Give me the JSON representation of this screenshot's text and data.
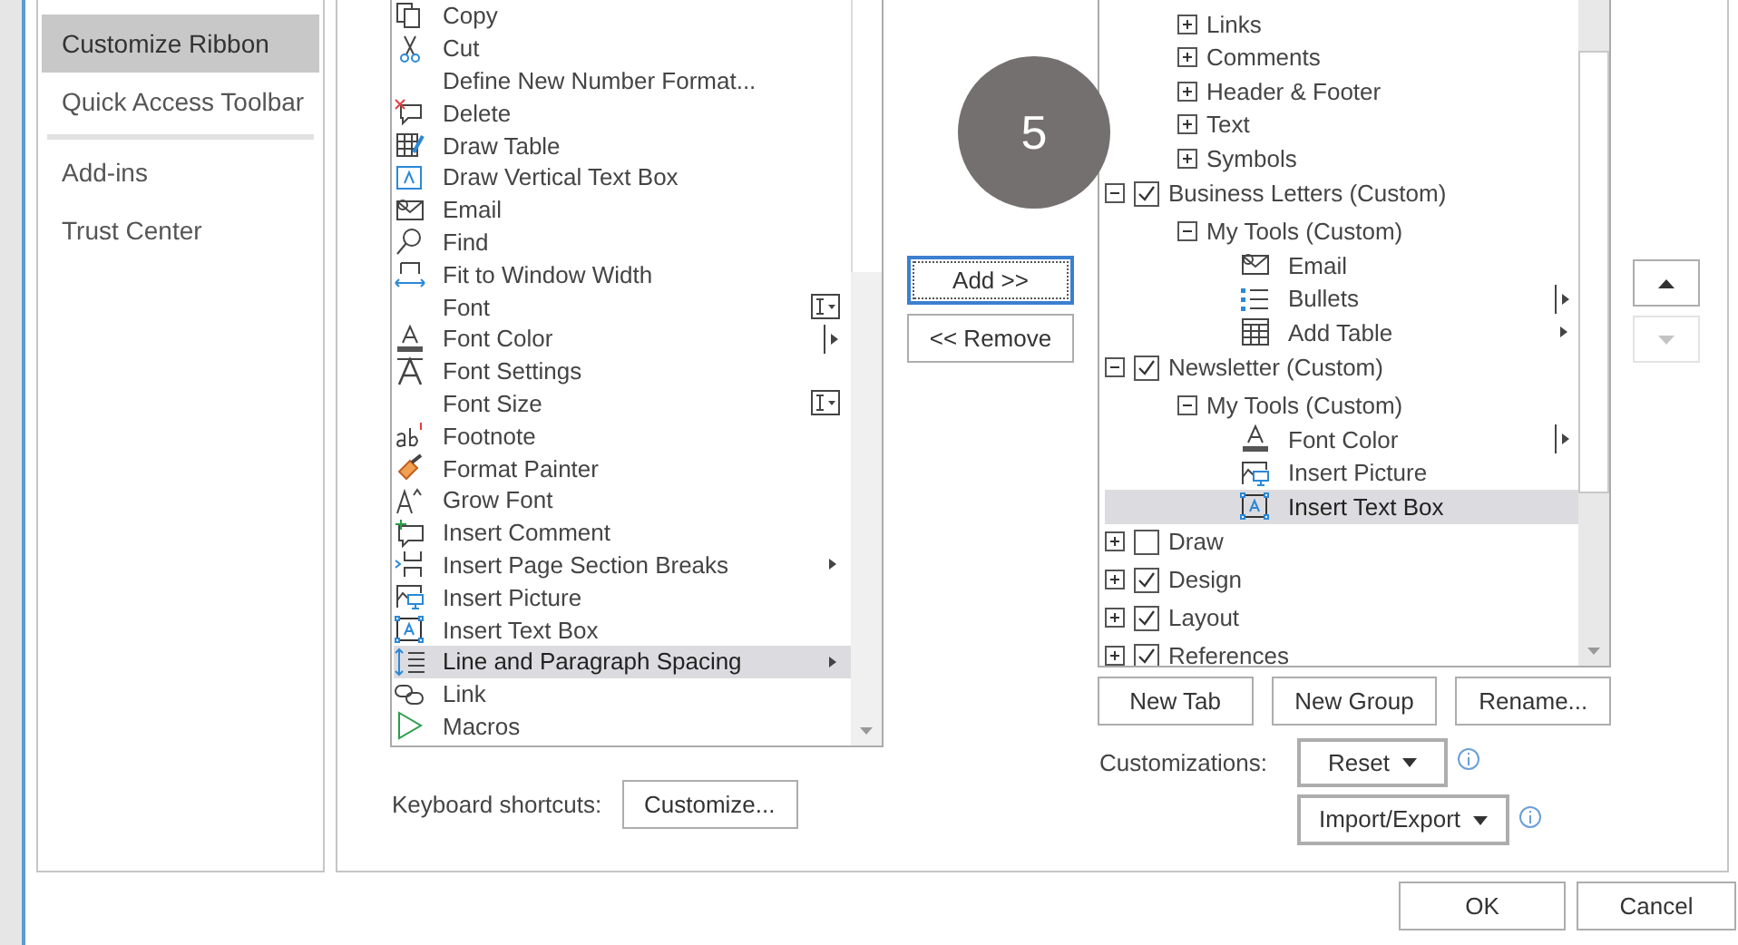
{
  "nav": {
    "items": [
      {
        "label": "Customize Ribbon",
        "selected": true
      },
      {
        "label": "Quick Access Toolbar",
        "selected": false
      },
      {
        "label": "Add-ins",
        "selected": false
      },
      {
        "label": "Trust Center",
        "selected": false
      }
    ]
  },
  "commands": [
    {
      "label": "Copy",
      "kind": "plain",
      "selected": false
    },
    {
      "label": "Cut",
      "kind": "plain",
      "selected": false
    },
    {
      "label": "Define New Number Format...",
      "kind": "plain",
      "selected": false
    },
    {
      "label": "Delete",
      "kind": "plain",
      "selected": false
    },
    {
      "label": "Draw Table",
      "kind": "plain",
      "selected": false
    },
    {
      "label": "Draw Vertical Text Box",
      "kind": "plain",
      "selected": false
    },
    {
      "label": "Email",
      "kind": "plain",
      "selected": false
    },
    {
      "label": "Find",
      "kind": "plain",
      "selected": false
    },
    {
      "label": "Fit to Window Width",
      "kind": "plain",
      "selected": false
    },
    {
      "label": "Font",
      "kind": "combo",
      "selected": false
    },
    {
      "label": "Font Color",
      "kind": "split",
      "selected": false
    },
    {
      "label": "Font Settings",
      "kind": "plain",
      "selected": false
    },
    {
      "label": "Font Size",
      "kind": "combo",
      "selected": false
    },
    {
      "label": "Footnote",
      "kind": "plain",
      "selected": false
    },
    {
      "label": "Format Painter",
      "kind": "plain",
      "selected": false
    },
    {
      "label": "Grow Font",
      "kind": "plain",
      "selected": false
    },
    {
      "label": "Insert Comment",
      "kind": "plain",
      "selected": false
    },
    {
      "label": "Insert Page  Section Breaks",
      "kind": "submenu",
      "selected": false
    },
    {
      "label": "Insert Picture",
      "kind": "plain",
      "selected": false
    },
    {
      "label": "Insert Text Box",
      "kind": "plain",
      "selected": false
    },
    {
      "label": "Line and Paragraph Spacing",
      "kind": "submenu",
      "selected": true
    },
    {
      "label": "Link",
      "kind": "plain",
      "selected": false
    },
    {
      "label": "Macros",
      "kind": "plain",
      "selected": false
    }
  ],
  "keyboard_shortcuts": {
    "label": "Keyboard shortcuts:",
    "button": "Customize..."
  },
  "add_button": "Add >>",
  "remove_button": "<< Remove",
  "step_badge": "5",
  "ribbon_tree": {
    "continued_groups": [
      {
        "label": "Links",
        "expanded": false
      },
      {
        "label": "Comments",
        "expanded": false
      },
      {
        "label": "Header & Footer",
        "expanded": false
      },
      {
        "label": "Text",
        "expanded": false
      },
      {
        "label": "Symbols",
        "expanded": false
      }
    ],
    "tabs": [
      {
        "label": "Business Letters (Custom)",
        "expanded": true,
        "checked": true,
        "children": [
          {
            "label": "My Tools (Custom)",
            "expanded": true,
            "children": [
              {
                "label": "Email",
                "kind": "plain",
                "selected": false
              },
              {
                "label": "Bullets",
                "kind": "split",
                "selected": false
              },
              {
                "label": "Add Table",
                "kind": "submenu",
                "selected": false
              }
            ]
          }
        ]
      },
      {
        "label": "Newsletter (Custom)",
        "expanded": true,
        "checked": true,
        "children": [
          {
            "label": "My Tools (Custom)",
            "expanded": true,
            "children": [
              {
                "label": "Font Color",
                "kind": "split",
                "selected": false
              },
              {
                "label": "Insert Picture",
                "kind": "plain",
                "selected": false
              },
              {
                "label": "Insert Text Box",
                "kind": "plain",
                "selected": true
              }
            ]
          }
        ]
      },
      {
        "label": "Draw",
        "expanded": false,
        "checked": false
      },
      {
        "label": "Design",
        "expanded": false,
        "checked": true
      },
      {
        "label": "Layout",
        "expanded": false,
        "checked": true
      },
      {
        "label": "References",
        "expanded": false,
        "checked": true
      }
    ]
  },
  "tree_buttons": [
    "New Tab",
    "New Group",
    "Rename..."
  ],
  "customizations": {
    "label": "Customizations:",
    "reset": "Reset",
    "import_export": "Import/Export"
  },
  "move_buttons": [
    {
      "kind": "up",
      "disabled": false
    },
    {
      "kind": "down",
      "disabled": true
    }
  ],
  "dialog_buttons": [
    "OK",
    "Cancel"
  ]
}
